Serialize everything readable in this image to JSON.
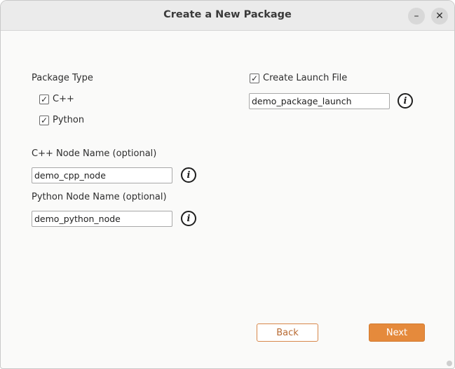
{
  "window": {
    "title": "Create a New Package",
    "minimize_label": "–",
    "close_label": "✕"
  },
  "package_type": {
    "label": "Package Type",
    "options": [
      {
        "label": "C++",
        "checked": true
      },
      {
        "label": "Python",
        "checked": true
      }
    ]
  },
  "launch_file": {
    "label": "Create Launch File",
    "checked": true,
    "value": "demo_package_launch"
  },
  "cpp_node": {
    "label": "C++ Node Name (optional)",
    "value": "demo_cpp_node"
  },
  "python_node": {
    "label": "Python Node Name (optional)",
    "value": "demo_python_node"
  },
  "info_icon_glyph": "i",
  "checkmark_glyph": "✓",
  "footer": {
    "back_label": "Back",
    "next_label": "Next"
  },
  "colors": {
    "accent": "#e58a3c",
    "accent_text": "#b86a32"
  }
}
